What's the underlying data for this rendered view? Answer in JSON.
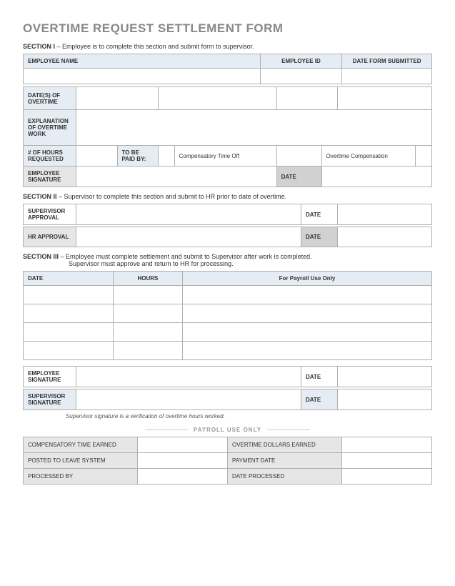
{
  "title": "OVERTIME REQUEST SETTLEMENT FORM",
  "section1": {
    "heading_bold": "SECTION I",
    "heading_rest": "  –  Employee is to complete this section and submit form to supervisor.",
    "employee_name_lbl": "EMPLOYEE NAME",
    "employee_id_lbl": "EMPLOYEE ID",
    "date_submitted_lbl": "DATE FORM SUBMITTED",
    "dates_ot_lbl": "DATE(S) OF OVERTIME",
    "explanation_lbl": "EXPLANATION OF OVERTIME WORK",
    "hours_req_lbl": "# OF HOURS REQUESTED",
    "paid_by_lbl": "TO BE PAID BY:",
    "comp_time_off": "Compensatory Time Off",
    "ot_comp": "Overtime Compensation",
    "emp_sig_lbl": "EMPLOYEE SIGNATURE",
    "date_lbl": "DATE"
  },
  "section2": {
    "heading_bold": "SECTION II",
    "heading_rest": "  –  Supervisor to complete this section and submit to HR prior to date of overtime.",
    "supervisor_approval_lbl": "SUPERVISOR APPROVAL",
    "hr_approval_lbl": "HR APPROVAL",
    "date_lbl": "DATE"
  },
  "section3": {
    "heading_bold": "SECTION III",
    "heading_line1": "  –  Employee must complete settlement and submit to Supervisor after work is completed.",
    "heading_line2": "Supervisor must approve and return to HR for processing.",
    "date_col": "DATE",
    "hours_col": "HOURS",
    "payroll_col": "For Payroll Use Only",
    "emp_sig_lbl": "EMPLOYEE SIGNATURE",
    "sup_sig_lbl": "SUPERVISOR SIGNATURE",
    "date_lbl": "DATE",
    "foot_note": "Supervisor signature is a verification of overtime hours worked."
  },
  "payroll": {
    "heading": "PAYROLL USE ONLY",
    "comp_time_earned": "COMPENSATORY TIME EARNED",
    "ot_dollars_earned": "OVERTIME DOLLARS EARNED",
    "posted_leave": "POSTED TO LEAVE SYSTEM",
    "payment_date": "PAYMENT DATE",
    "processed_by": "PROCESSED BY",
    "date_processed": "DATE PROCESSED"
  }
}
